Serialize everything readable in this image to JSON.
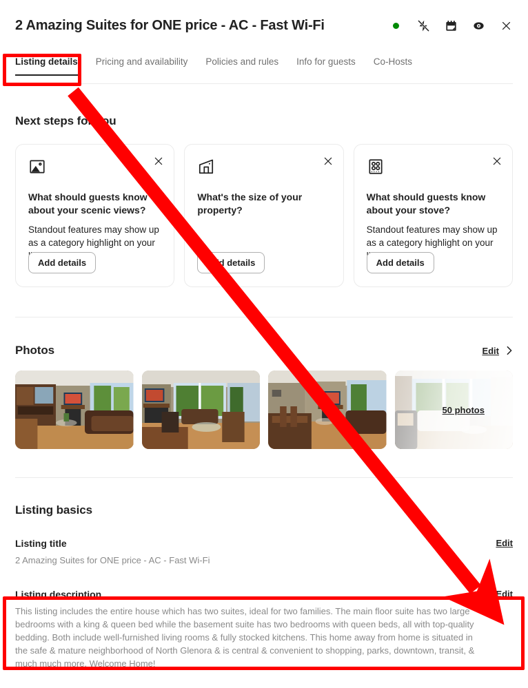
{
  "header": {
    "title": "2 Amazing Suites for ONE price - AC - Fast Wi-Fi",
    "status_color": "#008a05",
    "icons": [
      {
        "name": "status-dot",
        "label": "Listed"
      },
      {
        "name": "instant-book-off-icon",
        "label": "Instant Book off"
      },
      {
        "name": "calendar-icon",
        "label": "Calendar"
      },
      {
        "name": "preview-eye-icon",
        "label": "Preview listing"
      },
      {
        "name": "close-icon",
        "label": "Close"
      }
    ]
  },
  "tabs": [
    {
      "label": "Listing details",
      "active": true
    },
    {
      "label": "Pricing and availability",
      "active": false
    },
    {
      "label": "Policies and rules",
      "active": false
    },
    {
      "label": "Info for guests",
      "active": false
    },
    {
      "label": "Co-Hosts",
      "active": false
    }
  ],
  "next_steps": {
    "title": "Next steps for you",
    "cards": [
      {
        "icon": "image-icon",
        "heading": "What should guests know about your scenic views?",
        "body": "Standout features may show up as a category highlight on your listing.",
        "button": "Add details",
        "close": "×"
      },
      {
        "icon": "house-size-icon",
        "heading": "What's the size of your property?",
        "body": "",
        "button": "Add details",
        "close": "×"
      },
      {
        "icon": "stove-icon",
        "heading": "What should guests know about your stove?",
        "body": "Standout features may show up as a category highlight on your listing.",
        "button": "Add details",
        "close": "×"
      }
    ]
  },
  "photos": {
    "title": "Photos",
    "edit_label": "Edit",
    "more_count_label": "50 photos",
    "items": [
      {
        "alt": "Living room with fireplace and leather sofa"
      },
      {
        "alt": "Living room with bay windows and coffee table"
      },
      {
        "alt": "Dining table with living room and fireplace"
      },
      {
        "alt": "Bright sunroom with sofa and armchair"
      }
    ]
  },
  "listing_basics": {
    "title": "Listing basics",
    "fields": [
      {
        "label": "Listing title",
        "value": "2 Amazing Suites for ONE price - AC - Fast Wi-Fi",
        "edit_label": "Edit"
      },
      {
        "label": "Listing description",
        "value": "This listing includes the entire house which has two suites, ideal for two families. The main floor suite has two large bedrooms with a king & queen bed while the basement suite has two bedrooms with queen beds, all with top-quality bedding. Both include well-furnished living rooms & fully stocked kitchens. This home away from home is situated in the safe & mature neighborhood of North Glenora & is central & convenient to shopping, parks, downtown, transit, & much much more. Welcome Home!",
        "edit_label": "Edit"
      }
    ]
  },
  "annotations": {
    "highlight_color": "#ff0000",
    "boxes": [
      {
        "name": "listing-details-tab-highlight"
      },
      {
        "name": "listing-description-highlight"
      }
    ],
    "arrow": {
      "from": "listing-details-tab",
      "to": "listing-description-edit"
    }
  }
}
